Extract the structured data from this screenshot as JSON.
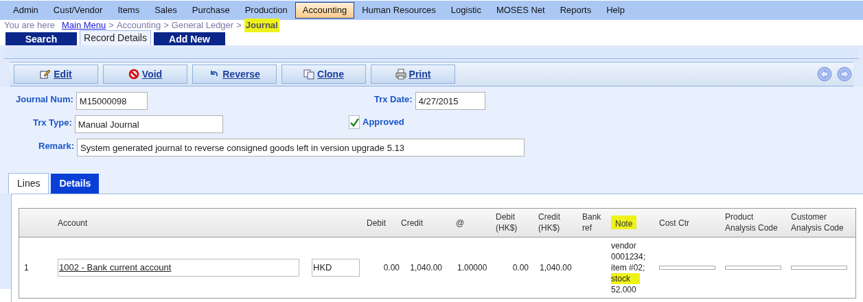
{
  "menu": [
    {
      "label": "Admin",
      "selected": false
    },
    {
      "label": "Cust/Vendor",
      "selected": false
    },
    {
      "label": "Items",
      "selected": false
    },
    {
      "label": "Sales",
      "selected": false
    },
    {
      "label": "Purchase",
      "selected": false
    },
    {
      "label": "Production",
      "selected": false
    },
    {
      "label": "Accounting",
      "selected": true
    },
    {
      "label": "Human Resources",
      "selected": false
    },
    {
      "label": "Logistic",
      "selected": false
    },
    {
      "label": "MOSES Net",
      "selected": false
    },
    {
      "label": "Reports",
      "selected": false
    },
    {
      "label": "Help",
      "selected": false
    }
  ],
  "breadcrumb": {
    "prefix": "You are here",
    "separator": ">",
    "items": [
      {
        "label": "Main Menu",
        "kind": "link",
        "highlighted": false
      },
      {
        "label": "Accounting",
        "kind": "plain",
        "highlighted": false
      },
      {
        "label": "General Ledger",
        "kind": "plain",
        "highlighted": false
      },
      {
        "label": "Journal",
        "kind": "current",
        "highlighted": true
      }
    ]
  },
  "page_tabs": [
    {
      "label": "Search",
      "selected": false
    },
    {
      "label": "Record Details",
      "selected": true
    },
    {
      "label": "Add New",
      "selected": false
    }
  ],
  "toolbar": {
    "buttons": [
      {
        "label": "Edit"
      },
      {
        "label": "Void"
      },
      {
        "label": "Reverse"
      },
      {
        "label": "Clone"
      },
      {
        "label": "Print"
      }
    ]
  },
  "form": {
    "journal_num": {
      "label": "Journal Num:",
      "value": "M15000098"
    },
    "trx_date": {
      "label": "Trx Date:",
      "value": "4/27/2015"
    },
    "trx_type": {
      "label": "Trx Type:",
      "value": "Manual Journal"
    },
    "approved": {
      "label": "Approved",
      "checked": true
    },
    "remark": {
      "label": "Remark:",
      "value": "System generated journal to reverse consigned goods left in version upgrade 5.13"
    }
  },
  "detail_tabs": [
    {
      "label": "Lines",
      "selected": true
    },
    {
      "label": "Details",
      "selected": false
    }
  ],
  "table": {
    "columns": [
      {
        "label": "Account",
        "highlighted": false
      },
      {
        "label": "Debit",
        "highlighted": false
      },
      {
        "label": "Credit",
        "highlighted": false
      },
      {
        "label": "@",
        "highlighted": false
      },
      {
        "label": "Debit (HK$)",
        "highlighted": false
      },
      {
        "label": "Credit (HK$)",
        "highlighted": false
      },
      {
        "label": "Bank ref",
        "highlighted": false
      },
      {
        "label": "Note",
        "highlighted": true
      },
      {
        "label": "Cost Ctr",
        "highlighted": false
      },
      {
        "label": "Product Analysis Code",
        "highlighted": false
      },
      {
        "label": "Customer Analysis Code",
        "highlighted": false
      }
    ],
    "rows": [
      {
        "number": "1",
        "account": "1002 - Bank current account",
        "currency": "HKD",
        "debit": "0.00",
        "credit": "1,040.00",
        "rate": "1.00000",
        "debit_hkd": "0.00",
        "credit_hkd": "1,040.00",
        "note": [
          {
            "text": "vendor",
            "highlighted": false
          },
          {
            "text": "0001234;",
            "highlighted": false
          },
          {
            "text": "item #02;",
            "highlighted": false
          },
          {
            "text": "stock",
            "highlighted": true
          },
          {
            "text": "52.000",
            "highlighted": false
          }
        ]
      }
    ]
  }
}
